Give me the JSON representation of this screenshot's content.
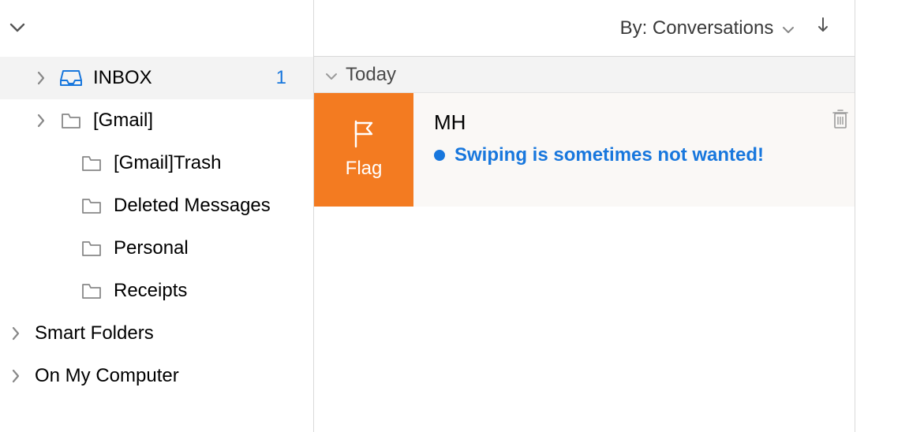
{
  "sidebar": {
    "folders": [
      {
        "label": "INBOX",
        "count": "1"
      },
      {
        "label": "[Gmail]"
      },
      {
        "label": "[Gmail]Trash"
      },
      {
        "label": "Deleted Messages"
      },
      {
        "label": "Personal"
      },
      {
        "label": "Receipts"
      }
    ],
    "groups": [
      {
        "label": "Smart Folders"
      },
      {
        "label": "On My Computer"
      }
    ]
  },
  "list": {
    "sort_by_prefix": "By: ",
    "sort_by_value": "Conversations",
    "group_label": "Today",
    "flag_action_label": "Flag",
    "message": {
      "sender": "MH",
      "subject": "Swiping is sometimes not wanted!"
    }
  }
}
